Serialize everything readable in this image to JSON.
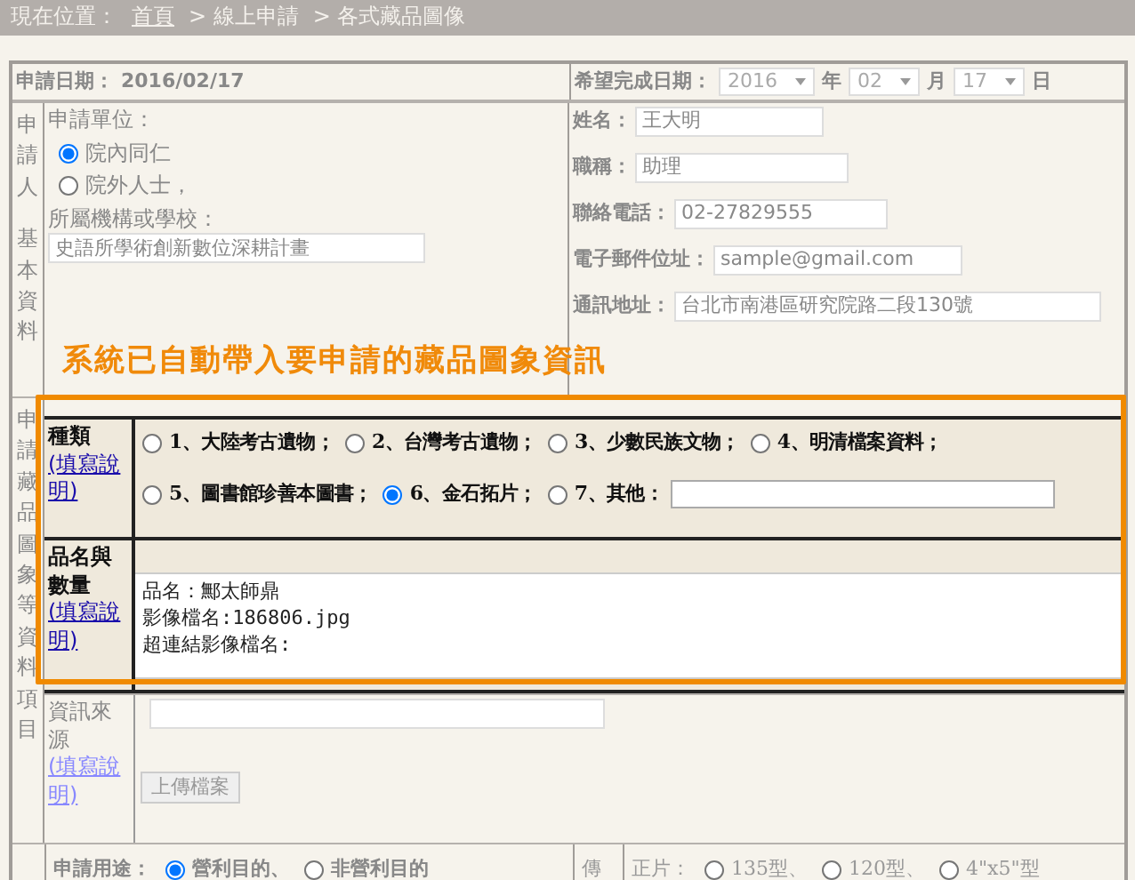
{
  "breadcrumb": {
    "label": "現在位置：",
    "items": [
      {
        "text": "首頁",
        "link": true
      },
      {
        "text": "> 線上申請",
        "link": false
      },
      {
        "text": "> 各式藏品圖像",
        "link": false
      }
    ]
  },
  "apply_date": {
    "label": "申請日期：",
    "value": "2016/02/17"
  },
  "due_date": {
    "label": "希望完成日期：",
    "parts": [
      {
        "kind": "select",
        "value": "2016"
      },
      {
        "kind": "text",
        "value": "年"
      },
      {
        "kind": "select",
        "value": "02"
      },
      {
        "kind": "text",
        "value": "月"
      },
      {
        "kind": "select",
        "value": "17"
      },
      {
        "kind": "text",
        "value": "日"
      }
    ]
  },
  "applicant": {
    "side_labels": [
      "申請人",
      "基本資料"
    ],
    "unit_label": "申請單位：",
    "units": [
      {
        "label": "院內同仁",
        "selected": true
      },
      {
        "label": "院外人士，",
        "selected": false
      }
    ],
    "org_label": "所屬機構或學校：",
    "org_value": "史語所學術創新數位深耕計畫",
    "fields": [
      {
        "label": "姓名：",
        "value": "王大明"
      },
      {
        "label": "職稱：",
        "value": "助理"
      },
      {
        "label": "聯絡電話：",
        "value": "02-27829555"
      },
      {
        "label": "電子郵件位址：",
        "value": "sample@gmail.com"
      },
      {
        "label": "通訊地址：",
        "value": "台北市南港區研究院路二段130號"
      }
    ]
  },
  "callout": "系統已自動帶入要申請的藏品圖象資訊",
  "items_section": {
    "side_label": "申請藏品圖象等資料項目",
    "category": {
      "label": "種類",
      "help": "(填寫說明)",
      "options": [
        {
          "label": "1、大陸考古遺物；",
          "selected": false,
          "kind": "plain"
        },
        {
          "label": "2、台灣考古遺物；",
          "selected": false,
          "kind": "plain"
        },
        {
          "label": "3、少數民族文物；",
          "selected": false,
          "kind": "plain"
        },
        {
          "label": "4、明清檔案資料；",
          "selected": false,
          "kind": "plain"
        },
        {
          "label": "5、圖書館珍善本圖書；",
          "selected": false,
          "kind": "plain"
        },
        {
          "label": "6、金石拓片；",
          "selected": true,
          "kind": "plain"
        },
        {
          "label": "7、其他：",
          "selected": false,
          "kind": "other"
        }
      ]
    },
    "name_qty": {
      "label": "品名與數量",
      "help": "(填寫說明)",
      "lines": [
        "品名：鄦太師鼎",
        "影像檔名:186806.jpg",
        "超連結影像檔名:"
      ]
    },
    "source": {
      "label": "資訊來源",
      "help": "(填寫說明)",
      "button": "上傳檔案"
    }
  },
  "usage": {
    "label": "申請用途：",
    "options": [
      {
        "label": "營利目的、",
        "selected": true
      },
      {
        "label": "非營利目的",
        "selected": false
      }
    ]
  },
  "delivery": {
    "side_label": "傳",
    "label": "正片：",
    "options": [
      {
        "label": "135型、",
        "selected": false
      },
      {
        "label": "120型、",
        "selected": false
      },
      {
        "label": "4\"x5\"型",
        "selected": false
      }
    ]
  }
}
